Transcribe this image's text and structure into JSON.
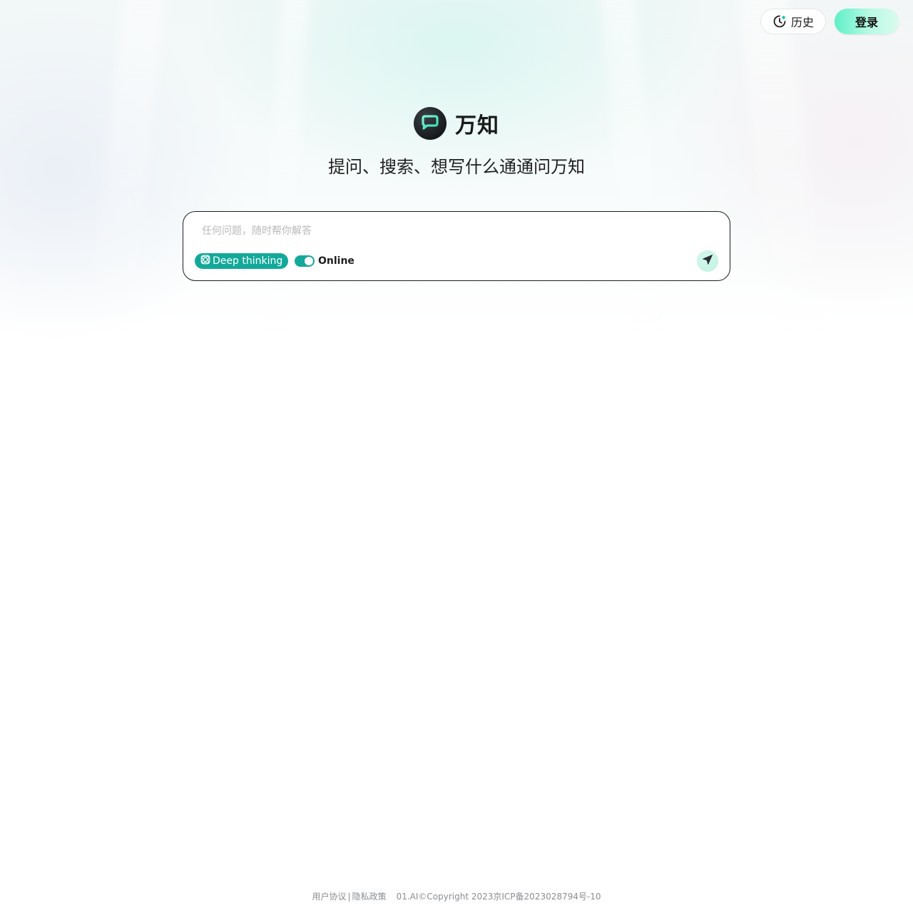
{
  "header": {
    "history_label": "历史",
    "login_label": "登录"
  },
  "brand": {
    "name": "万知",
    "tagline": "提问、搜索、想写什么通通问万知"
  },
  "composer": {
    "placeholder": "任何问题，随时帮你解答",
    "value": "",
    "deep_thinking_label": "Deep thinking",
    "online_label": "Online",
    "online_enabled": true
  },
  "footer": {
    "user_agreement": "用户协议",
    "separator": "|",
    "privacy_policy": "隐私政策",
    "copyright": "01.AI©Copyright 2023京ICP备2023028794号-10"
  },
  "colors": {
    "accent": "#13a99a",
    "login_gradient_start": "#5ff0c8",
    "border": "#1e1e1e",
    "footer_text": "#8a8d91"
  },
  "icons": {
    "history": "clock-icon",
    "deep_thinking": "atom-icon",
    "send": "send-arrow-icon",
    "logo": "chat-bubble-logo-icon"
  }
}
